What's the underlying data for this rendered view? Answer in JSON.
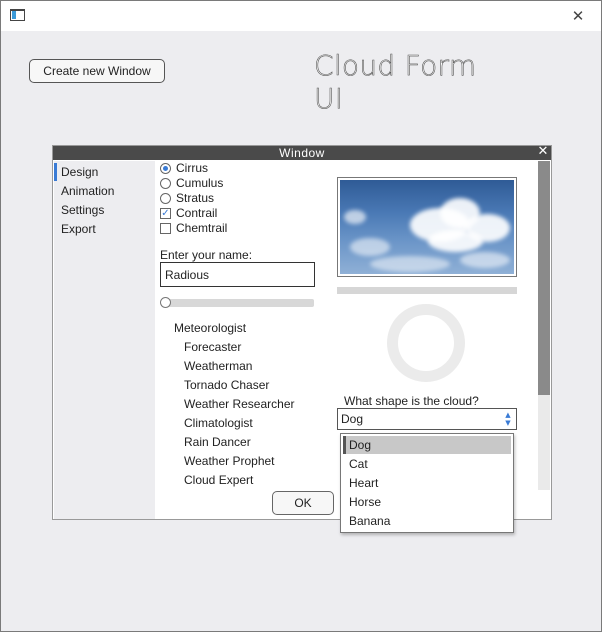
{
  "os_window": {
    "close_glyph": "✕",
    "app_icon": "window-icon"
  },
  "main": {
    "create_button": "Create new Window",
    "app_title": "Cloud Form UI"
  },
  "inner_window": {
    "title": "Window",
    "close_glyph": "✕",
    "sidebar": [
      "Design",
      "Animation",
      "Settings",
      "Export"
    ],
    "active_sidebar_item": "Design",
    "cloud_types": [
      {
        "label": "Cirrus",
        "selected": true
      },
      {
        "label": "Cumulus",
        "selected": false
      },
      {
        "label": "Stratus",
        "selected": false
      }
    ],
    "checkboxes": [
      {
        "label": "Contrail",
        "checked": true
      },
      {
        "label": "Chemtrail",
        "checked": false
      }
    ],
    "name_label": "Enter your name:",
    "name_value": "Radious",
    "slider_value": 0,
    "tree": {
      "root": "Meteorologist",
      "children": [
        "Forecaster",
        "Weatherman",
        "Tornado Chaser",
        "Weather Researcher",
        "Climatologist",
        "Rain Dancer",
        "Weather Prophet",
        "Cloud Expert"
      ]
    },
    "ok_button": "OK",
    "shape_question": "What shape is the cloud?",
    "shape_selected": "Dog",
    "shape_options": [
      "Dog",
      "Cat",
      "Heart",
      "Horse",
      "Banana"
    ],
    "colors": {
      "accent": "#3a7bd5",
      "titlebar": "#4a4a4a",
      "sidebar_bg": "#ededf0"
    }
  }
}
